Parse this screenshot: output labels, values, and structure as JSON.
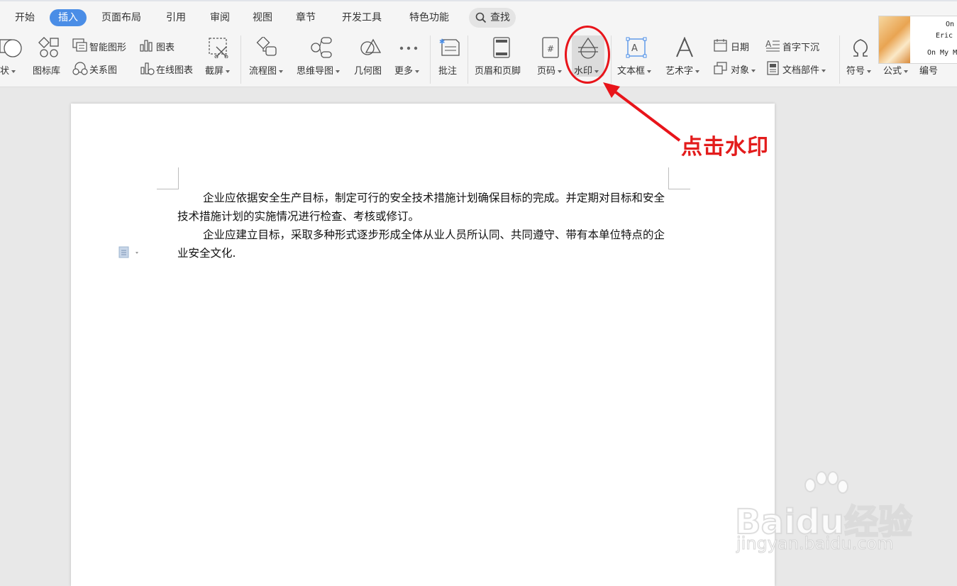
{
  "tabs": [
    "开始",
    "插入",
    "页面布局",
    "引用",
    "审阅",
    "视图",
    "章节",
    "开发工具",
    "特色功能"
  ],
  "active_tab": "插入",
  "search_label": "查找",
  "ribbon": {
    "shape": "形状",
    "icon_lib": "图标库",
    "smart_art": "智能图形",
    "relation": "关系图",
    "chart": "图表",
    "online_chart": "在线图表",
    "screenshot": "截屏",
    "flowchart": "流程图",
    "mindmap": "思维导图",
    "geometry": "几何图",
    "more": "更多",
    "comment": "批注",
    "header_footer": "页眉和页脚",
    "page_number": "页码",
    "watermark": "水印",
    "textbox": "文本框",
    "wordart": "艺术字",
    "date": "日期",
    "object": "对象",
    "dropcap": "首字下沉",
    "doc_parts": "文档部件",
    "symbol": "符号",
    "formula": "公式",
    "numbering": "编号"
  },
  "music_widget": {
    "line1": "On M",
    "line2": "Eric",
    "line3": "On My M"
  },
  "document": {
    "paragraphs": [
      "企业应依据安全生产目标，制定可行的安全技术措施计划确保目标的完成。并定期对目标和安全技术措施计划的实施情况进行检查、考核或修订。",
      "企业应建立目标，采取多种形式逐步形成全体从业人员所认同、共同遵守、带有本单位特点的企业安全文化."
    ]
  },
  "annotation": {
    "text": "点击水印",
    "color": "#e31c1c"
  },
  "watermark_site": {
    "logo": "Baidu经验",
    "url": "jingyan.baidu.com"
  },
  "colors": {
    "accent": "#4a8de6",
    "annotation_red": "#e8141a"
  }
}
